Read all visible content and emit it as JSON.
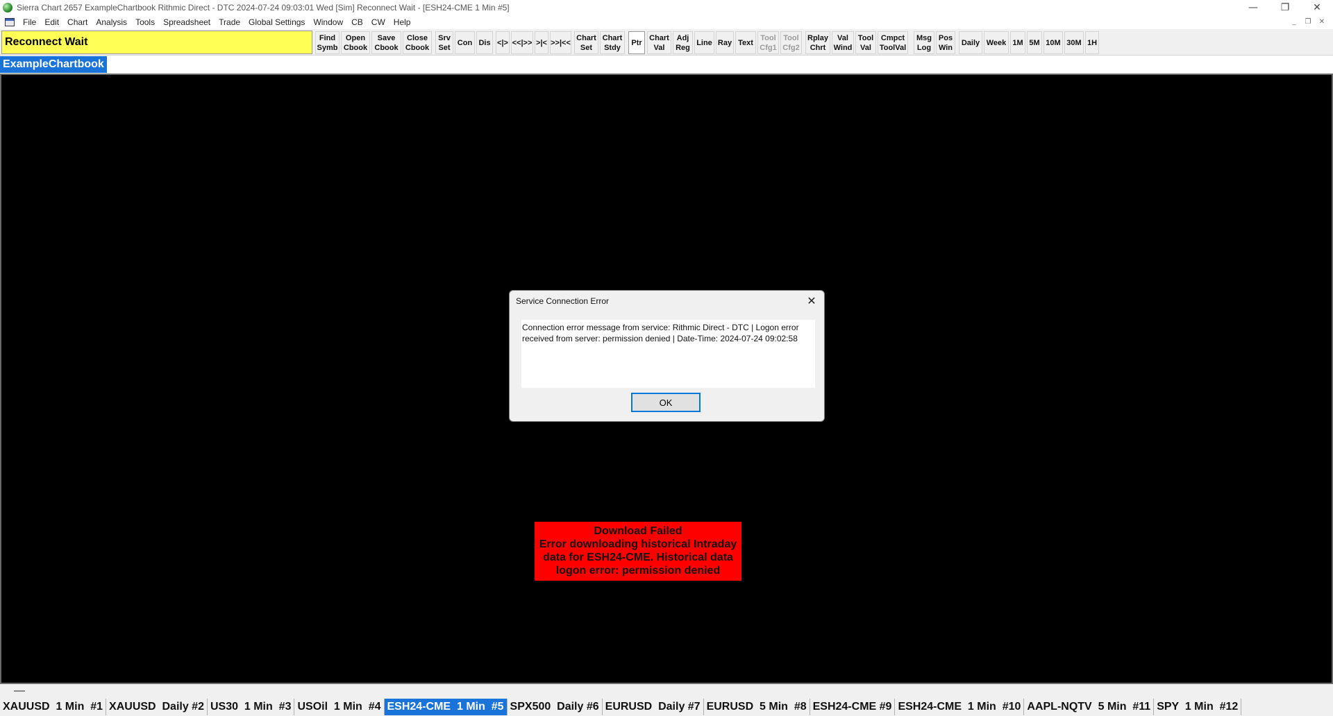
{
  "window": {
    "title": "Sierra Chart 2657 ExampleChartbook Rithmic Direct - DTC 2024-07-24  09:03:01 Wed [Sim] Reconnect Wait - [ESH24-CME  1 Min  #5]",
    "controls": [
      "—",
      "❐",
      "✕"
    ]
  },
  "menu": {
    "items": [
      "File",
      "Edit",
      "Chart",
      "Analysis",
      "Tools",
      "Spreadsheet",
      "Trade",
      "Global Settings",
      "Window",
      "CB",
      "CW",
      "Help"
    ],
    "mdi_controls": [
      "_",
      "❐",
      "✕"
    ]
  },
  "toolbar": {
    "status": "Reconnect Wait",
    "buttons": [
      {
        "label": "Find\nSymb"
      },
      {
        "label": "Open\nCbook"
      },
      {
        "label": "Save\nCbook"
      },
      {
        "label": "Close\nCbook"
      },
      {
        "label": "Srv\nSet"
      },
      {
        "label": "Con"
      },
      {
        "label": "Dis"
      },
      {
        "label": "<|>"
      },
      {
        "label": "<<|>>"
      },
      {
        "label": ">|<"
      },
      {
        "label": ">>|<<"
      },
      {
        "label": "Chart\nSet"
      },
      {
        "label": "Chart\nStdy"
      },
      {
        "label": "Ptr"
      },
      {
        "label": "Chart\nVal"
      },
      {
        "label": "Adj\nReg"
      },
      {
        "label": "Line"
      },
      {
        "label": "Ray"
      },
      {
        "label": "Text"
      },
      {
        "label": "Tool\nCfg1"
      },
      {
        "label": "Tool\nCfg2"
      },
      {
        "label": "Rplay\nChrt"
      },
      {
        "label": "Val\nWind"
      },
      {
        "label": "Tool\nVal"
      },
      {
        "label": "Cmpct\nToolVal"
      },
      {
        "label": "Msg\nLog"
      },
      {
        "label": "Pos\nWin"
      },
      {
        "label": "Daily"
      },
      {
        "label": "Week"
      },
      {
        "label": "1M"
      },
      {
        "label": "5M"
      },
      {
        "label": "10M"
      },
      {
        "label": "30M"
      },
      {
        "label": "1H"
      }
    ]
  },
  "chartbook": {
    "tab_label": "ExampleChartbook"
  },
  "dialog": {
    "title": "Service Connection Error",
    "message": "Connection error message from service: Rithmic Direct - DTC | Logon error received from server: permission denied | Date-Time: 2024-07-24 09:02:58",
    "ok_label": "OK",
    "close_glyph": "✕"
  },
  "download_error": {
    "lines": [
      "Download Failed",
      "Error downloading historical Intraday",
      "data for ESH24-CME. Historical data",
      "logon error: permission denied"
    ],
    "color": "#ff0000"
  },
  "chart_tabs": {
    "active_index": 4,
    "tabs": [
      "XAUUSD  1 Min  #1",
      "XAUUSD  Daily #2",
      "US30  1 Min  #3",
      "USOil  1 Min  #4",
      "ESH24-CME  1 Min  #5",
      "SPX500  Daily #6",
      "EURUSD  Daily #7",
      "EURUSD  5 Min  #8",
      "ESH24-CME #9",
      "ESH24-CME  1 Min  #10",
      "AAPL-NQTV  5 Min  #11",
      "SPY  1 Min  #12"
    ]
  },
  "colors": {
    "status_yellow": "#ffff55",
    "active_tab_blue": "#1a73d9",
    "chart_background": "#000000",
    "error_red": "#ff0000"
  }
}
